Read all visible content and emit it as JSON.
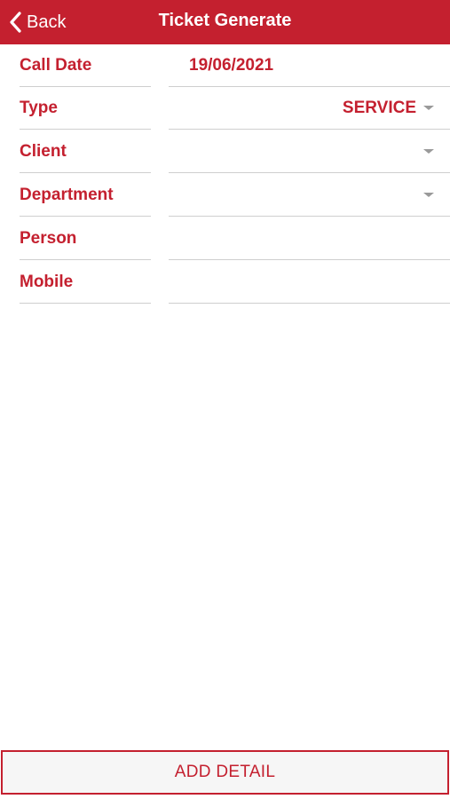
{
  "header": {
    "back_label": "Back",
    "title": "Ticket Generate"
  },
  "form": {
    "call_date": {
      "label": "Call Date",
      "value": "19/06/2021"
    },
    "type": {
      "label": "Type",
      "value": "SERVICE"
    },
    "client": {
      "label": "Client",
      "value": ""
    },
    "department": {
      "label": "Department",
      "value": ""
    },
    "person": {
      "label": "Person",
      "value": ""
    },
    "mobile": {
      "label": "Mobile",
      "value": ""
    }
  },
  "actions": {
    "add_detail_label": "ADD DETAIL"
  },
  "colors": {
    "accent": "#c4202f",
    "divider": "#cfcfcf",
    "caret": "#9a9a9a"
  }
}
